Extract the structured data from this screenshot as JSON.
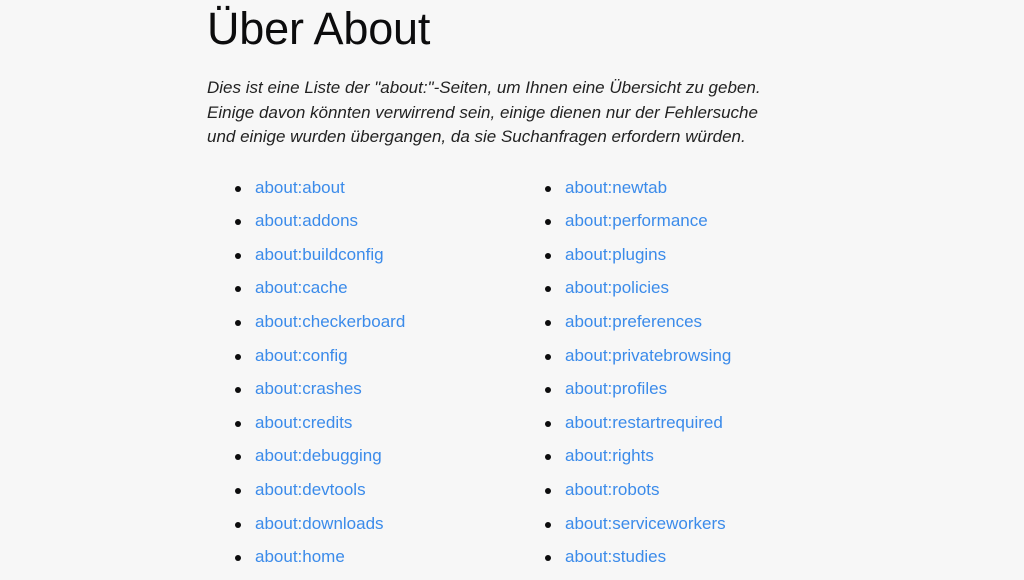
{
  "page": {
    "title": "Über About",
    "background_color": "#f7f7f7",
    "link_color": "#3b8bea",
    "text_color": "#222222",
    "title_color": "#0c0c0d"
  },
  "intro": {
    "line1": "Dies ist eine Liste der \"about:\"-Seiten, um Ihnen eine Übersicht zu geben.",
    "line2": "Einige davon könnten verwirrend sein, einige dienen nur der Fehlersuche",
    "line3": "und einige wurden übergangen, da sie Suchanfragen erfordern würden."
  },
  "columns": {
    "left": [
      {
        "label": "about:about"
      },
      {
        "label": "about:addons"
      },
      {
        "label": "about:buildconfig"
      },
      {
        "label": "about:cache"
      },
      {
        "label": "about:checkerboard"
      },
      {
        "label": "about:config"
      },
      {
        "label": "about:crashes"
      },
      {
        "label": "about:credits"
      },
      {
        "label": "about:debugging"
      },
      {
        "label": "about:devtools"
      },
      {
        "label": "about:downloads"
      },
      {
        "label": "about:home"
      }
    ],
    "right": [
      {
        "label": "about:newtab"
      },
      {
        "label": "about:performance"
      },
      {
        "label": "about:plugins"
      },
      {
        "label": "about:policies"
      },
      {
        "label": "about:preferences"
      },
      {
        "label": "about:privatebrowsing"
      },
      {
        "label": "about:profiles"
      },
      {
        "label": "about:restartrequired"
      },
      {
        "label": "about:rights"
      },
      {
        "label": "about:robots"
      },
      {
        "label": "about:serviceworkers"
      },
      {
        "label": "about:studies"
      }
    ]
  }
}
